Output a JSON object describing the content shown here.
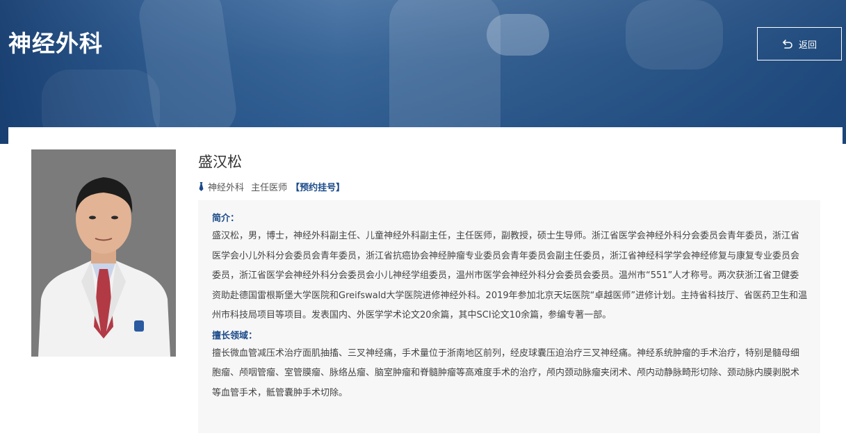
{
  "header": {
    "department_title": "神经外科",
    "back_label": "返回"
  },
  "doctor": {
    "name": "盛汉松",
    "department": "神经外科",
    "title": "主任医师",
    "booking_link": "【预约挂号】"
  },
  "profile": {
    "intro_heading": "简介：",
    "intro_text": "盛汉松，男，博士，神经外科副主任、儿童神经外科副主任，主任医师，副教授，硕士生导师。浙江省医学会神经外科分会委员会青年委员，浙江省医学会小儿外科分会委员会青年委员，浙江省抗癌协会神经肿瘤专业委员会青年委员会副主任委员，浙江省神经科学学会神经修复与康复专业委员会委员，浙江省医学会神经外科分会委员会小儿神经学组委员，温州市医学会神经外科分会委员会委员。温州市“551”人才称号。两次获浙江省卫健委资助赴德国雷根斯堡大学医院和Greifswald大学医院进修神经外科。2019年参加北京天坛医院“卓越医师”进修计划。主持省科技厅、省医药卫生和温州市科技局项目等项目。发表国内、外医学学术论文20余篇，其中SCI论文10余篇，参编专著一部。",
    "specialty_heading": "擅长领域：",
    "specialty_text": "擅长微血管减压术治疗面肌抽搐、三叉神经痛，手术量位于浙南地区前列，经皮球囊压迫治疗三叉神经痛。神经系统肿瘤的手术治疗，特别是髓母细胞瘤、颅咽管瘤、室管膜瘤、脉络丛瘤、脑室肿瘤和脊髓肿瘤等高难度手术的治疗，颅内颈动脉瘤夹闭术、颅内动静脉畸形切除、颈动脉内膜剥脱术等血管手术，骶管囊肿手术切除。"
  },
  "colors": {
    "banner": "#224d82",
    "accent": "#1a4a8a",
    "info_bg": "#f7f7f7"
  }
}
